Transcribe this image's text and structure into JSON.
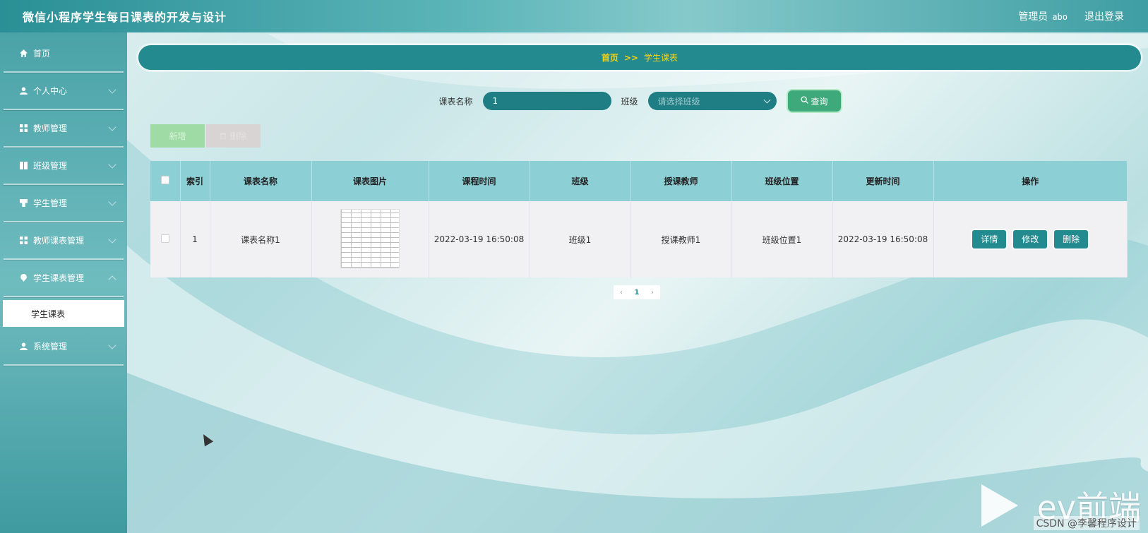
{
  "header": {
    "app_title": "微信小程序学生每日课表的开发与设计",
    "role": "管理员",
    "username": "abo",
    "logout": "退出登录"
  },
  "sidebar": {
    "items": [
      {
        "label": "首页",
        "icon": "home-icon"
      },
      {
        "label": "个人中心",
        "icon": "user-icon"
      },
      {
        "label": "教师管理",
        "icon": "grid-icon"
      },
      {
        "label": "班级管理",
        "icon": "book-icon"
      },
      {
        "label": "学生管理",
        "icon": "cup-icon"
      },
      {
        "label": "教师课表管理",
        "icon": "grid-icon"
      },
      {
        "label": "学生课表管理",
        "icon": "pin-icon"
      },
      {
        "label": "系统管理",
        "icon": "user-icon"
      }
    ],
    "active_sub": "学生课表"
  },
  "breadcrumb": {
    "home": "首页",
    "separator": ">>",
    "current": "学生课表"
  },
  "search": {
    "name_label": "课表名称",
    "name_value": "1",
    "class_label": "班级",
    "class_placeholder": "请选择班级",
    "query_button": "查询"
  },
  "actions": {
    "add": "新增",
    "delete": "删除"
  },
  "table": {
    "headers": [
      "索引",
      "课表名称",
      "课表图片",
      "课程时间",
      "班级",
      "授课教师",
      "班级位置",
      "更新时间",
      "操作"
    ],
    "rows": [
      {
        "index": "1",
        "name": "课表名称1",
        "course_time": "2022-03-19 16:50:08",
        "class": "班级1",
        "teacher": "授课教师1",
        "location": "班级位置1",
        "updated": "2022-03-19 16:50:08",
        "ops": [
          "详情",
          "修改",
          "删除"
        ]
      }
    ]
  },
  "pagination": {
    "current_page": "1"
  },
  "overlay": {
    "watermark": "ev前端",
    "csdn": "CSDN @李馨程序设计"
  },
  "colors": {
    "accent": "#238a8f",
    "crumb_text": "#f5d313",
    "query_button": "#3ea97a"
  }
}
